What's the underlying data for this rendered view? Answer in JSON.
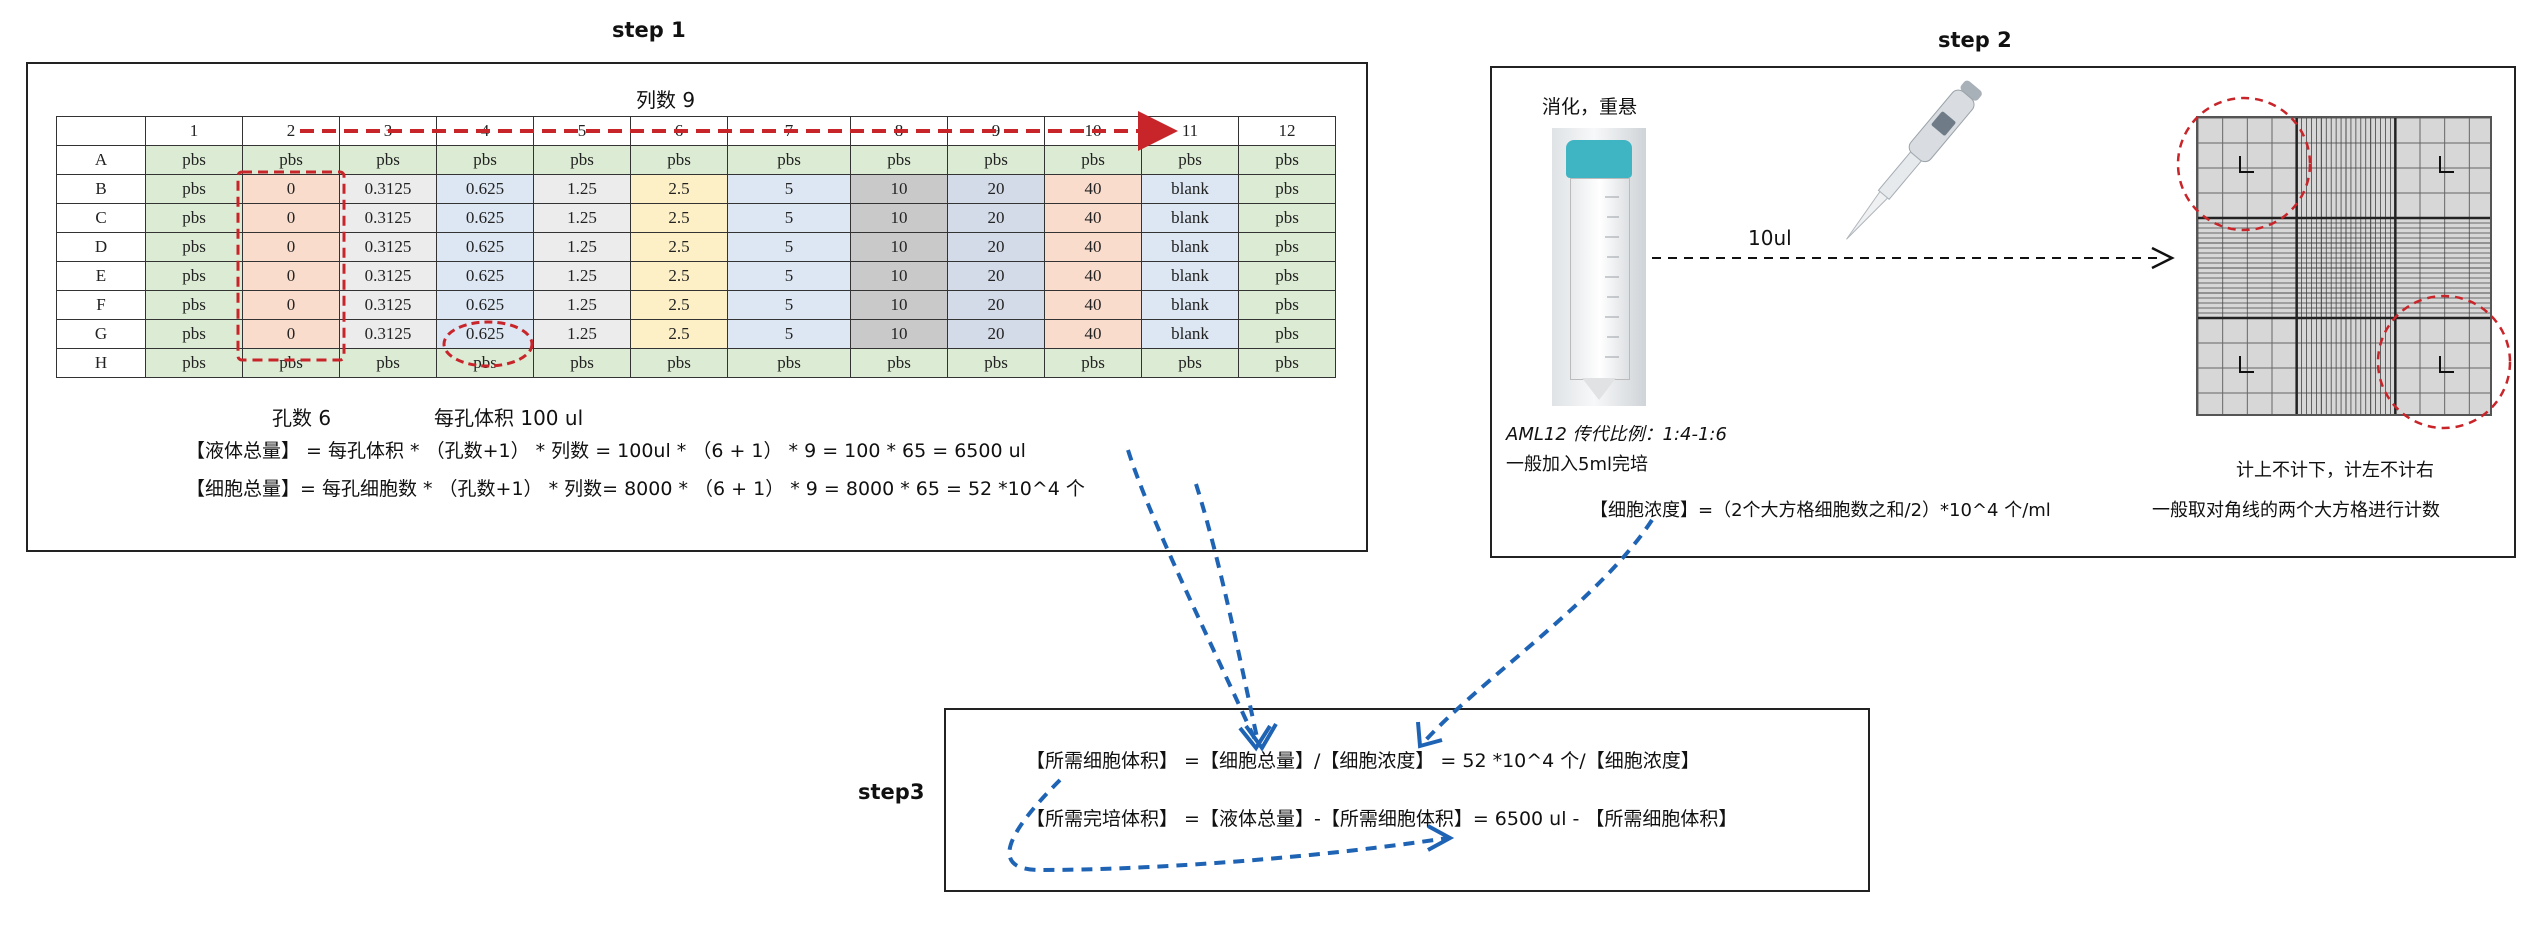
{
  "step1": {
    "title": "step 1",
    "col_count_label": "列数 9",
    "well_count_label": "孔数 6",
    "well_volume_label": "每孔体积 100 ul",
    "formula_liquid": "【液体总量】 = 每孔体积 * （孔数+1） * 列数 = 100ul * （6 + 1） * 9 = 100 * 65 = 6500 ul",
    "formula_cells": "【细胞总量】= 每孔细胞数 * （孔数+1） * 列数= 8000 * （6 + 1） * 9 = 8000 * 65 = 52 *10^4 个",
    "plate": {
      "col_headers": [
        "",
        "1",
        "2",
        "3",
        "4",
        "5",
        "6",
        "7",
        "8",
        "9",
        "10",
        "11",
        "12"
      ],
      "rows": [
        {
          "label": "A",
          "cells": [
            "pbs",
            "pbs",
            "pbs",
            "pbs",
            "pbs",
            "pbs",
            "pbs",
            "pbs",
            "pbs",
            "pbs",
            "pbs",
            "pbs"
          ]
        },
        {
          "label": "B",
          "cells": [
            "pbs",
            "0",
            "0.3125",
            "0.625",
            "1.25",
            "2.5",
            "5",
            "10",
            "20",
            "40",
            "blank",
            "pbs"
          ]
        },
        {
          "label": "C",
          "cells": [
            "pbs",
            "0",
            "0.3125",
            "0.625",
            "1.25",
            "2.5",
            "5",
            "10",
            "20",
            "40",
            "blank",
            "pbs"
          ]
        },
        {
          "label": "D",
          "cells": [
            "pbs",
            "0",
            "0.3125",
            "0.625",
            "1.25",
            "2.5",
            "5",
            "10",
            "20",
            "40",
            "blank",
            "pbs"
          ]
        },
        {
          "label": "E",
          "cells": [
            "pbs",
            "0",
            "0.3125",
            "0.625",
            "1.25",
            "2.5",
            "5",
            "10",
            "20",
            "40",
            "blank",
            "pbs"
          ]
        },
        {
          "label": "F",
          "cells": [
            "pbs",
            "0",
            "0.3125",
            "0.625",
            "1.25",
            "2.5",
            "5",
            "10",
            "20",
            "40",
            "blank",
            "pbs"
          ]
        },
        {
          "label": "G",
          "cells": [
            "pbs",
            "0",
            "0.3125",
            "0.625",
            "1.25",
            "2.5",
            "5",
            "10",
            "20",
            "40",
            "blank",
            "pbs"
          ]
        },
        {
          "label": "H",
          "cells": [
            "pbs",
            "pbs",
            "pbs",
            "pbs",
            "pbs",
            "pbs",
            "pbs",
            "pbs",
            "pbs",
            "pbs",
            "pbs",
            "pbs"
          ]
        }
      ]
    }
  },
  "step2": {
    "title": "step 2",
    "digest_label": "消化，重悬",
    "volume_label": "10ul",
    "passage_label": "AML12 传代比例：1:4-1:6",
    "medium_label": "一般加入5ml完培",
    "count_rule": "计上不计下，计左不计右",
    "concentration_formula": "【细胞浓度】=（2个大方格细胞数之和/2）*10^4 个/ml",
    "diagonal_note": "一般取对角线的两个大方格进行计数"
  },
  "step3": {
    "title": "step3",
    "formula_cell_volume": "【所需细胞体积】 =【细胞总量】/【细胞浓度】 = 52 *10^4 个/【细胞浓度】",
    "formula_medium_volume": "【所需完培体积】 =【液体总量】-【所需细胞体积】= 6500 ul - 【所需细胞体积】"
  },
  "colors": {
    "red_annotation": "#c8252a",
    "blue_arrow": "#1f64b4",
    "pbs_fill": "#dcebd3",
    "tube_cap": "#3fb5c3"
  }
}
